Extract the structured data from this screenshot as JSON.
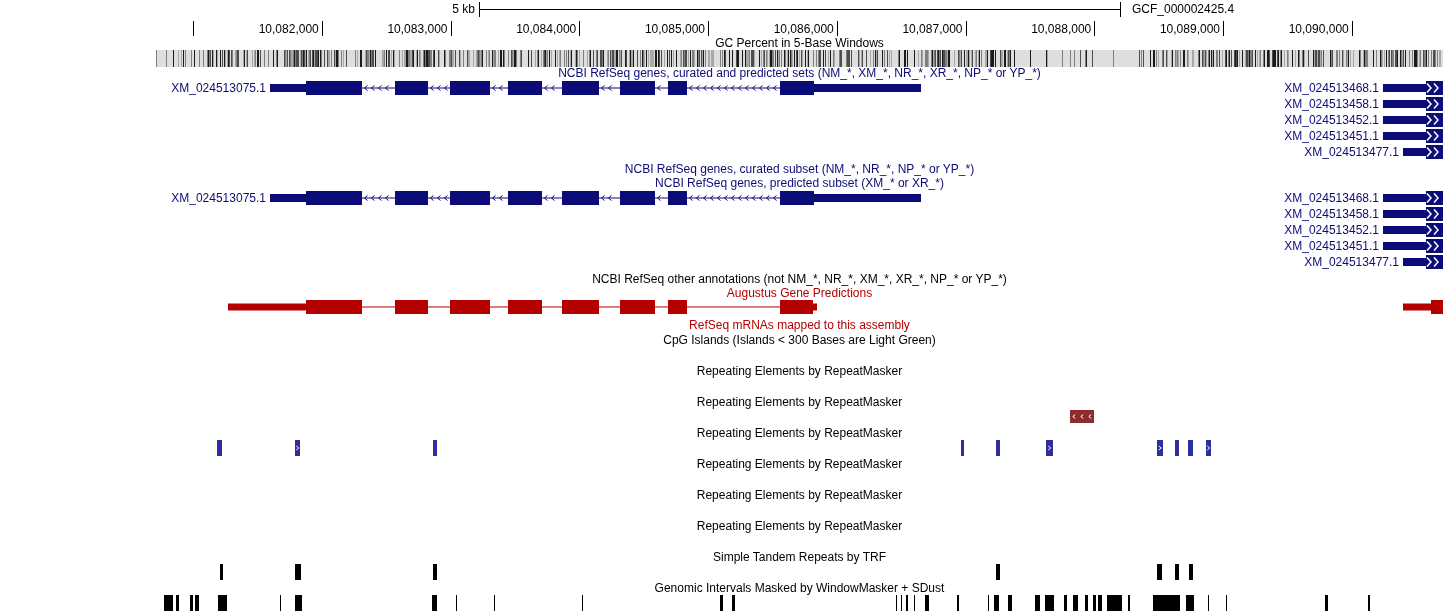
{
  "ruler": {
    "scale_label": "5 kb",
    "assembly": "GCF_000002425.4",
    "ticks": [
      "10,082,000",
      "10,083,000",
      "10,084,000",
      "10,085,000",
      "10,086,000",
      "10,087,000",
      "10,088,000",
      "10,089,000",
      "10,090,000"
    ]
  },
  "tracks": [
    {
      "kind": "gc_percent",
      "title": "GC Percent in 5-Base Windows"
    },
    {
      "kind": "genes",
      "title": "NCBI RefSeq genes, curated and predicted sets (NM_*, XM_*, NR_*, XR_*, NP_* or YP_*)",
      "rows": [
        {
          "genes": [
            {
              "label": "XM_024513075.1",
              "reverse_strand": true
            },
            {
              "label": "XM_024513468.1",
              "reverse_strand": false
            }
          ]
        },
        {
          "genes": [
            {
              "label": "XM_024513458.1",
              "reverse_strand": false
            }
          ]
        },
        {
          "genes": [
            {
              "label": "XM_024513452.1",
              "reverse_strand": false
            }
          ]
        },
        {
          "genes": [
            {
              "label": "XM_024513451.1",
              "reverse_strand": false
            }
          ]
        },
        {
          "genes": [
            {
              "label": "XM_024513477.1",
              "reverse_strand": false
            }
          ]
        }
      ]
    },
    {
      "kind": "genes",
      "title": "NCBI RefSeq genes, curated subset (NM_*, NR_*, NP_* or YP_*)"
    },
    {
      "kind": "genes",
      "title": "NCBI RefSeq genes, predicted subset (XM_* or XR_*)",
      "rows": [
        {
          "genes": [
            {
              "label": "XM_024513075.1",
              "reverse_strand": true
            },
            {
              "label": "XM_024513468.1",
              "reverse_strand": false
            }
          ]
        },
        {
          "genes": [
            {
              "label": "XM_024513458.1",
              "reverse_strand": false
            }
          ]
        },
        {
          "genes": [
            {
              "label": "XM_024513452.1",
              "reverse_strand": false
            }
          ]
        },
        {
          "genes": [
            {
              "label": "XM_024513451.1",
              "reverse_strand": false
            }
          ]
        },
        {
          "genes": [
            {
              "label": "XM_024513477.1",
              "reverse_strand": false
            }
          ]
        }
      ]
    },
    {
      "kind": "annotation",
      "title": "NCBI RefSeq other annotations (not NM_*, NR_*, XM_*, XR_*, NP_* or YP_*)"
    },
    {
      "kind": "gene_prediction",
      "title": "Augustus Gene Predictions"
    },
    {
      "kind": "mrna_alignments",
      "title": "RefSeq mRNAs mapped to this assembly"
    },
    {
      "kind": "cpg",
      "title": "CpG Islands (Islands < 300 Bases are Light Green)"
    },
    {
      "kind": "repeatmasker",
      "title": "Repeating Elements by RepeatMasker"
    },
    {
      "kind": "repeatmasker",
      "title": "Repeating Elements by RepeatMasker"
    },
    {
      "kind": "repeatmasker",
      "title": "Repeating Elements by RepeatMasker"
    },
    {
      "kind": "repeatmasker",
      "title": "Repeating Elements by RepeatMasker"
    },
    {
      "kind": "repeatmasker",
      "title": "Repeating Elements by RepeatMasker"
    },
    {
      "kind": "repeatmasker",
      "title": "Repeating Elements by RepeatMasker"
    },
    {
      "kind": "tandem_repeats",
      "title": "Simple Tandem Repeats by TRF"
    },
    {
      "kind": "masked_intervals",
      "title": "Genomic Intervals Masked by WindowMasker + SDust"
    }
  ]
}
